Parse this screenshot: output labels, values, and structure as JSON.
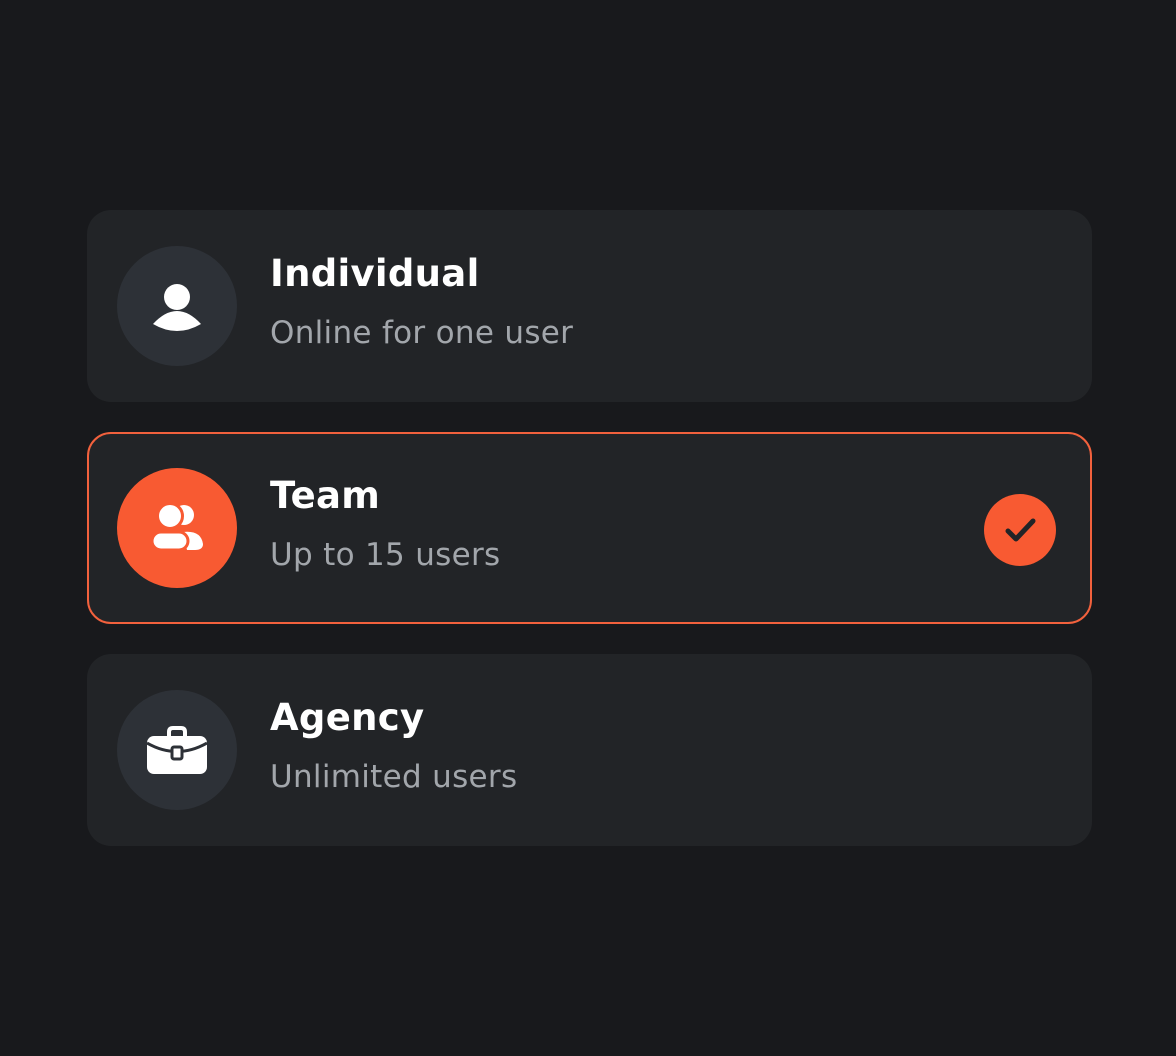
{
  "colors": {
    "background": "#18191c",
    "card": "#222427",
    "accent": "#f85a32",
    "icon_bg": "#2d3137",
    "title": "#ffffff",
    "subtitle": "#a2a6ab"
  },
  "plans": [
    {
      "id": "individual",
      "title": "Individual",
      "subtitle": "Online for one user",
      "icon": "user-icon",
      "selected": false
    },
    {
      "id": "team",
      "title": "Team",
      "subtitle": "Up to 15 users",
      "icon": "users-icon",
      "selected": true
    },
    {
      "id": "agency",
      "title": "Agency",
      "subtitle": "Unlimited users",
      "icon": "briefcase-icon",
      "selected": false
    }
  ]
}
